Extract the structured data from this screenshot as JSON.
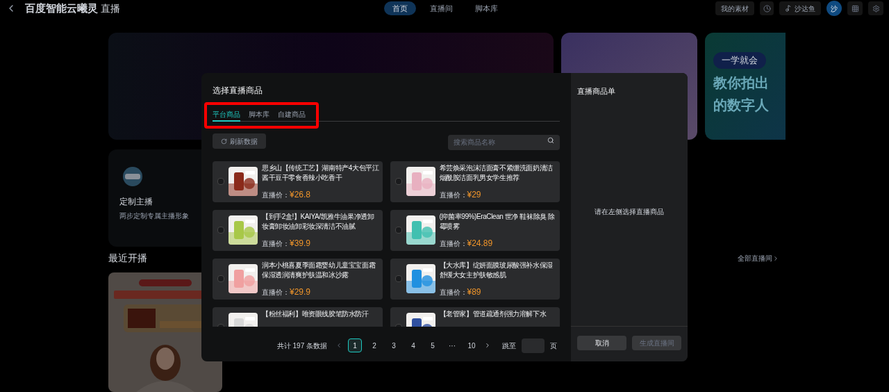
{
  "top_bar": {
    "brand": "百度智能云曦灵",
    "product": "直播",
    "nav": [
      {
        "label": "首页",
        "selected": true
      },
      {
        "label": "直播间",
        "selected": false
      },
      {
        "label": "脚本库",
        "selected": false
      }
    ],
    "materials_button": "我的素材",
    "account_button": "沙达鱼",
    "avatar": "沙"
  },
  "home": {
    "promo_card": {
      "badge": "一学就会",
      "heading_lines": [
        "教你拍出",
        "的数字人"
      ]
    },
    "feature_card": {
      "title": "定制主播",
      "subtitle": "两步定制专属主播形象"
    },
    "recent_title": "最近开播",
    "all_link": "全部直播间"
  },
  "dialog": {
    "title": "选择直播商品",
    "tabs": [
      {
        "label": "平台商品",
        "selected": true
      },
      {
        "label": "脚本库",
        "selected": false
      },
      {
        "label": "自建商品",
        "selected": false
      }
    ],
    "refresh_button": "刷新数据",
    "search": {
      "placeholder": "搜索商品名称"
    },
    "products": [
      {
        "title": "思乡山【传统工艺】湖南特产4大包平江酱干豆干零食香辣小吃香干",
        "price_label": "直播价：",
        "price": "¥26.8",
        "checked": false
      },
      {
        "title": "希芸焕采泡沫洁面膏不紧绷洗面奶清洁烟酰胺洁面乳男女学生推荐",
        "price_label": "直播价：",
        "price": "¥29",
        "checked": false
      },
      {
        "title": "【到手2盒!】KAIYA/凯雅牛油果净透卸妆膏卸妆油卸彩妆深清洁不油腻",
        "price_label": "直播价：",
        "price": "¥39.9",
        "checked": false
      },
      {
        "title": "(抑菌率99%)EraClean 世净 鞋袜除臭 除霉喷雾",
        "price_label": "直播价：",
        "price": "¥24.89",
        "checked": false
      },
      {
        "title": "润本小桃喜夏季面霜婴幼儿童宝宝面霜保湿透润清爽护肤温和冰沙露",
        "price_label": "直播价：",
        "price": "¥29.9",
        "checked": false
      },
      {
        "title": "【大水库】绽妍面膜玻尿酸强补水保湿舒缓大女主护肤敏感肌",
        "price_label": "直播价：",
        "price": "¥89",
        "checked": false
      },
      {
        "title": "【粉丝福利】唯资眼线胶笔防水防汗",
        "checked": false
      },
      {
        "title": "【老管家】管道疏通剂强力溶解下水",
        "checked": false
      }
    ],
    "pagination": {
      "total": "共计 197 条数据",
      "pages": [
        {
          "label": "1",
          "selected": true
        },
        {
          "label": "2",
          "selected": false
        },
        {
          "label": "3",
          "selected": false
        },
        {
          "label": "4",
          "selected": false
        },
        {
          "label": "5",
          "selected": false
        },
        {
          "label": "···",
          "selected": false
        },
        {
          "label": "10",
          "selected": false
        }
      ],
      "jump_label": "跳至",
      "page_suffix": "页"
    },
    "side_panel": {
      "title": "直播商品单",
      "empty_text": "请在左侧选择直播商品",
      "cancel_button": {
        "label": "取消",
        "disabled": false
      },
      "create_button": {
        "label": "生成直播间",
        "disabled": true
      }
    }
  }
}
